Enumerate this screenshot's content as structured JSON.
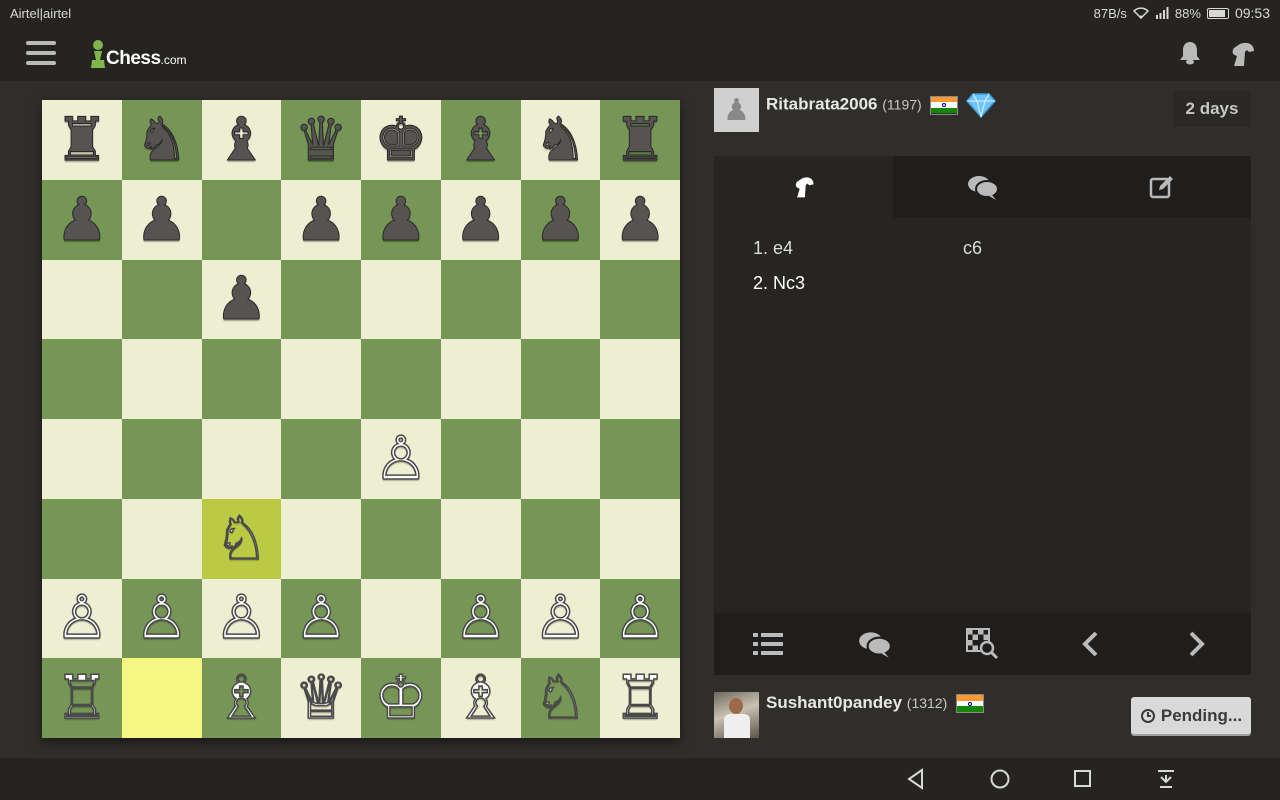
{
  "status": {
    "carrier": "Airtel|airtel",
    "speed": "87B/s",
    "battery": "88%",
    "battery_level": 0.88,
    "time": "09:53"
  },
  "appbar": {
    "brand": "Chess",
    "tld": ".com"
  },
  "opponent": {
    "name": "Ritabrata2006",
    "rating": "(1197)",
    "time_left": "2 days"
  },
  "me": {
    "name": "Sushant0pandey",
    "rating": "(1312)",
    "status_button": "Pending..."
  },
  "moves": [
    {
      "white": "1. e4",
      "black": "c6"
    },
    {
      "white": "2. Nc3",
      "black": ""
    }
  ],
  "board": [
    [
      "♜",
      "♞",
      "♝",
      "♛",
      "♚",
      "♝",
      "♞",
      "♜"
    ],
    [
      "♟",
      "♟",
      "",
      "♟",
      "♟",
      "♟",
      "♟",
      "♟"
    ],
    [
      "",
      "",
      "♟",
      "",
      "",
      "",
      "",
      ""
    ],
    [
      "",
      "",
      "",
      "",
      "",
      "",
      "",
      ""
    ],
    [
      "",
      "",
      "",
      "",
      "♙",
      "",
      "",
      ""
    ],
    [
      "",
      "",
      "♘",
      "",
      "",
      "",
      "",
      ""
    ],
    [
      "♙",
      "♙",
      "♙",
      "♙",
      "",
      "♙",
      "♙",
      "♙"
    ],
    [
      "♖",
      "",
      "♗",
      "♕",
      "♔",
      "♗",
      "♘",
      "♖"
    ]
  ],
  "highlighted_squares": [
    "b1",
    "c3"
  ],
  "colors": {
    "light_square": "#eeeed2",
    "dark_square": "#769656",
    "highlight_light": "#f6f683",
    "highlight_dark": "#baca44",
    "background": "#302e2b"
  }
}
